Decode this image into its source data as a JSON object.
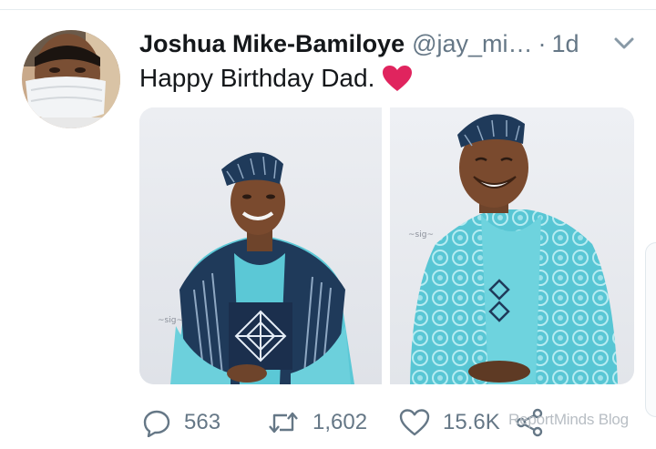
{
  "tweet": {
    "author_name": "Joshua Mike-Bamiloye",
    "author_handle": "@jay_mi…",
    "separator": "·",
    "time_ago": "1d",
    "text": "Happy Birthday Dad.",
    "emoji": "red-heart-icon",
    "media": [
      {
        "name": "photo-left",
        "description_icon": "photo"
      },
      {
        "name": "photo-right",
        "description_icon": "photo"
      }
    ]
  },
  "actions": {
    "reply_count": "563",
    "retweet_count": "1,602",
    "like_count": "15.6K",
    "reply_icon": "reply-icon",
    "retweet_icon": "retweet-icon",
    "like_icon": "heart-outline-icon",
    "share_icon": "share-icon"
  },
  "watermark": "ReportMinds Blog",
  "colors": {
    "text_primary": "#14171a",
    "text_secondary": "#657786",
    "heart_red": "#e0245e",
    "photo_bg": "#e9eaee",
    "outfit_teal": "#5bc8d6",
    "outfit_navy": "#1f3a5a"
  }
}
